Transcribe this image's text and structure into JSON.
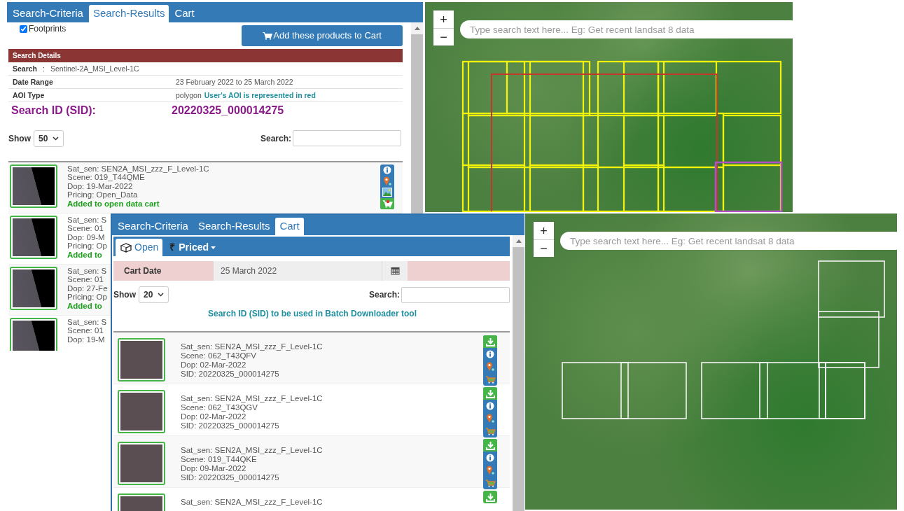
{
  "search_panel": {
    "tabs": [
      {
        "label": "Search-Criteria",
        "selected": false
      },
      {
        "label": "Search-Results",
        "selected": true
      },
      {
        "label": "Cart",
        "selected": false
      }
    ],
    "footprints": {
      "label": "Footprints",
      "checked": true
    },
    "add_button": "Add these products to Cart",
    "details_title": "Search Details",
    "details": [
      {
        "label": "Search",
        "separator": ":",
        "value": "Sentinel-2A_MSI_Level-1C"
      },
      {
        "label": "Date Range",
        "value": "23 February 2022 to 25 March 2022"
      },
      {
        "label": "AOI Type",
        "value": "polygon",
        "note": "User's AOI is represented in red"
      }
    ],
    "sid": {
      "label": "Search ID (SID):",
      "value": "20220325_000014275"
    },
    "show_label": "Show",
    "page_size": "50",
    "search_label": "Search:",
    "results": [
      {
        "lines": [
          "Sat_sen: SEN2A_MSI_zzz_F_Level-1C",
          "Scene: 019_T44QME",
          "Dop: 19-Mar-2022",
          "Pricing: Open_Data"
        ],
        "status": "Added to open data cart",
        "actions": [
          {
            "kind": "info"
          },
          {
            "kind": "pin"
          },
          {
            "kind": "image"
          },
          {
            "kind": "cart",
            "added": true
          }
        ]
      },
      {
        "lines": [
          "Sat_sen: S",
          "Scene: 01",
          "Dop: 09-M",
          "Pricing: Op"
        ],
        "status": "Added to"
      },
      {
        "lines": [
          "Sat_sen: S",
          "Scene: 01",
          "Dop: 27-Fe",
          "Pricing: Op"
        ],
        "status": "Added to"
      },
      {
        "lines": [
          "Sat_sen: S",
          "Scene: 01",
          "Dop: 19-M"
        ]
      }
    ]
  },
  "top_map": {
    "zoom_in": "+",
    "zoom_out": "−",
    "search": {
      "placeholder": "Type search text here... Eg: Get recent landsat 8 data"
    }
  },
  "cart_panel": {
    "tabs": [
      {
        "label": "Search-Criteria",
        "selected": false
      },
      {
        "label": "Search-Results",
        "selected": false
      },
      {
        "label": "Cart",
        "selected": true
      }
    ],
    "subtabs": [
      {
        "kind": "open",
        "label": "Open",
        "selected": true
      },
      {
        "kind": "dropdown",
        "symbol": "₹",
        "label": "Priced",
        "selected": false
      }
    ],
    "cart_date": {
      "label": "Cart Date",
      "value": "25 March 2022"
    },
    "show_label": "Show",
    "page_size": "20",
    "search_label": "Search:",
    "sid_note": "Search ID (SID) to be used in Batch Downloader tool",
    "items": [
      {
        "lines": [
          "Sat_sen: SEN2A_MSI_zzz_F_Level-1C",
          "Scene: 062_T43QFV",
          "Dop: 02-Mar-2022",
          "SID: 20220325_000014275"
        ],
        "actions": [
          {
            "kind": "download"
          },
          {
            "kind": "info"
          },
          {
            "kind": "pin"
          },
          {
            "kind": "cart",
            "added": false
          }
        ]
      },
      {
        "lines": [
          "Sat_sen: SEN2A_MSI_zzz_F_Level-1C",
          "Scene: 062_T43QGV",
          "Dop: 02-Mar-2022",
          "SID: 20220325_000014275"
        ],
        "actions": [
          {
            "kind": "download"
          },
          {
            "kind": "info"
          },
          {
            "kind": "pin"
          },
          {
            "kind": "cart",
            "added": false
          }
        ]
      },
      {
        "lines": [
          "Sat_sen: SEN2A_MSI_zzz_F_Level-1C",
          "Scene: 019_T44QKE",
          "Dop: 09-Mar-2022",
          "SID: 20220325_000014275"
        ],
        "actions": [
          {
            "kind": "download"
          },
          {
            "kind": "info"
          },
          {
            "kind": "pin"
          },
          {
            "kind": "cart",
            "added": false
          }
        ]
      },
      {
        "lines": [
          "Sat_sen: SEN2A_MSI_zzz_F_Level-1C"
        ],
        "actions": [
          {
            "kind": "download"
          }
        ]
      }
    ]
  },
  "bottom_map": {
    "zoom_in": "+",
    "zoom_out": "−",
    "search": {
      "placeholder": "Type search text here... Eg: Get recent landsat 8 data"
    }
  }
}
